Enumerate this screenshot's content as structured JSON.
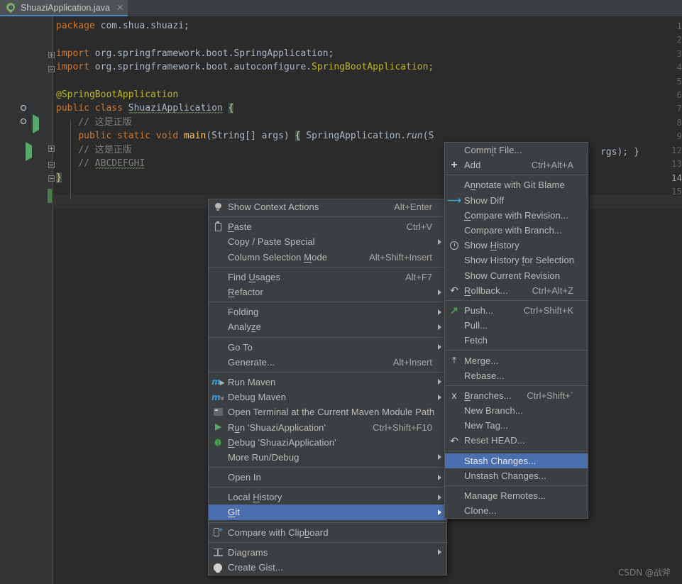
{
  "window": {
    "theme_bg": "#2b2b2b",
    "accent": "#4b6eaf",
    "menu_bg": "#3c3f41"
  },
  "tab": {
    "title": "ShuaziApplication.java",
    "close_label": "✕",
    "icon": "spring-boot-class-icon"
  },
  "editor": {
    "lines": [
      {
        "num": "1",
        "segments": [
          {
            "t": "package ",
            "c": "kw"
          },
          {
            "t": "com.shua.shuazi;",
            "c": "id"
          }
        ]
      },
      {
        "num": "2",
        "segments": []
      },
      {
        "num": "3",
        "segments": [
          {
            "t": "import ",
            "c": "kw"
          },
          {
            "t": "org.springframework.boot.SpringApplication;",
            "c": "id"
          }
        ]
      },
      {
        "num": "4",
        "segments": [
          {
            "t": "import ",
            "c": "kw"
          },
          {
            "t": "org.springframework.boot.autoconfigure.",
            "c": "id"
          },
          {
            "t": "SpringBootApplication;",
            "c": "ann"
          }
        ]
      },
      {
        "num": "5",
        "segments": []
      },
      {
        "num": "6",
        "segments": [
          {
            "t": "@SpringBootApplication",
            "c": "ann"
          }
        ]
      },
      {
        "num": "7",
        "segments": [
          {
            "t": "public ",
            "c": "kw"
          },
          {
            "t": "class ",
            "c": "kw"
          },
          {
            "t": "ShuaziApplication",
            "c": "squig"
          },
          {
            "t": " ",
            "c": "id"
          },
          {
            "t": "{",
            "c": "brace-hl"
          }
        ]
      },
      {
        "num": "8",
        "segments": [
          {
            "t": "    // 这是正版",
            "c": "cmt"
          }
        ]
      },
      {
        "num": "9",
        "segments": [
          {
            "t": "    ",
            "c": "id"
          },
          {
            "t": "public ",
            "c": "kw"
          },
          {
            "t": "static ",
            "c": "kw"
          },
          {
            "t": "void ",
            "c": "kw"
          },
          {
            "t": "main",
            "c": "mth"
          },
          {
            "t": "(String[] args) ",
            "c": "id"
          },
          {
            "t": "{",
            "c": "brace-hl"
          },
          {
            "t": " SpringApplication.",
            "c": "id"
          },
          {
            "t": "run",
            "c": "itl"
          },
          {
            "t": "(S",
            "c": "id"
          }
        ]
      },
      {
        "num": "12",
        "segments": [
          {
            "t": "    // 这是正版",
            "c": "cmt"
          }
        ]
      },
      {
        "num": "13",
        "segments": [
          {
            "t": "    // ",
            "c": "cmt"
          },
          {
            "t": "ABCDEFGHI",
            "c": "cmt squig"
          }
        ]
      },
      {
        "num": "14",
        "segments": [
          {
            "t": "}",
            "c": "brace-hl"
          }
        ]
      },
      {
        "num": "15",
        "segments": []
      }
    ],
    "line9_tail": "rgs); }",
    "current_line": "14"
  },
  "context_menu": {
    "items": [
      {
        "label": "Show Context Actions",
        "accel": "Alt+Enter",
        "icon": "lightbulb-icon",
        "arrow": false,
        "sep_after": true
      },
      {
        "label": "Paste",
        "mnemonic": "P",
        "accel": "Ctrl+V",
        "icon": "clipboard-icon",
        "arrow": false
      },
      {
        "label": "Copy / Paste Special",
        "accel": "",
        "icon": "",
        "arrow": true
      },
      {
        "label": "Column Selection Mode",
        "mnemonic": "M",
        "accel": "Alt+Shift+Insert",
        "icon": "",
        "arrow": false,
        "sep_after": true
      },
      {
        "label": "Find Usages",
        "mnemonic": "U",
        "accel": "Alt+F7",
        "icon": "",
        "arrow": false
      },
      {
        "label": "Refactor",
        "mnemonic": "R",
        "accel": "",
        "icon": "",
        "arrow": true,
        "sep_after": true
      },
      {
        "label": "Folding",
        "accel": "",
        "icon": "",
        "arrow": true
      },
      {
        "label": "Analyze",
        "mnemonic": "z",
        "accel": "",
        "icon": "",
        "arrow": true,
        "sep_after": true
      },
      {
        "label": "Go To",
        "accel": "",
        "icon": "",
        "arrow": true
      },
      {
        "label": "Generate...",
        "accel": "Alt+Insert",
        "icon": "",
        "arrow": false,
        "sep_after": true
      },
      {
        "label": "Run Maven",
        "accel": "",
        "icon": "maven-run-icon",
        "arrow": true
      },
      {
        "label": "Debug Maven",
        "accel": "",
        "icon": "maven-debug-icon",
        "arrow": true
      },
      {
        "label": "Open Terminal at the Current Maven Module Path",
        "accel": "",
        "icon": "terminal-icon",
        "arrow": false
      },
      {
        "label": "Run 'ShuaziApplication'",
        "mnemonic": "u",
        "accel": "Ctrl+Shift+F10",
        "icon": "run-play-icon",
        "arrow": false
      },
      {
        "label": "Debug 'ShuaziApplication'",
        "mnemonic": "D",
        "accel": "",
        "icon": "debug-bug-icon",
        "arrow": false
      },
      {
        "label": "More Run/Debug",
        "accel": "",
        "icon": "",
        "arrow": true,
        "sep_after": true
      },
      {
        "label": "Open In",
        "accel": "",
        "icon": "",
        "arrow": true,
        "sep_after": true
      },
      {
        "label": "Local History",
        "mnemonic": "H",
        "accel": "",
        "icon": "",
        "arrow": true
      },
      {
        "label": "Git",
        "mnemonic": "G",
        "accel": "",
        "icon": "",
        "arrow": true,
        "selected": true,
        "sep_after": true
      },
      {
        "label": "Compare with Clipboard",
        "mnemonic": "b",
        "accel": "",
        "icon": "compare-clipboard-icon",
        "arrow": false,
        "sep_after": true
      },
      {
        "label": "Diagrams",
        "accel": "",
        "icon": "diagram-icon",
        "arrow": true
      },
      {
        "label": "Create Gist...",
        "accel": "",
        "icon": "github-icon",
        "arrow": false
      }
    ]
  },
  "git_submenu": {
    "items": [
      {
        "label": "Commit File...",
        "mnemonic": "i",
        "accel": "",
        "icon": ""
      },
      {
        "label": "Add",
        "accel": "Ctrl+Alt+A",
        "icon": "plus-icon",
        "sep_after": true
      },
      {
        "label": "Annotate with Git Blame",
        "mnemonic": "n",
        "accel": "",
        "icon": ""
      },
      {
        "label": "Show Diff",
        "accel": "",
        "icon": "show-diff-icon"
      },
      {
        "label": "Compare with Revision...",
        "mnemonic": "C",
        "accel": "",
        "icon": ""
      },
      {
        "label": "Compare with Branch...",
        "accel": "",
        "icon": ""
      },
      {
        "label": "Show History",
        "mnemonic": "H",
        "accel": "",
        "icon": "clock-icon"
      },
      {
        "label": "Show History for Selection",
        "mnemonic": "f",
        "accel": "",
        "icon": ""
      },
      {
        "label": "Show Current Revision",
        "accel": "",
        "icon": ""
      },
      {
        "label": "Rollback...",
        "mnemonic": "R",
        "accel": "Ctrl+Alt+Z",
        "icon": "undo-icon",
        "sep_after": true
      },
      {
        "label": "Push...",
        "accel": "Ctrl+Shift+K",
        "icon": "push-arrow-icon"
      },
      {
        "label": "Pull...",
        "accel": "",
        "icon": ""
      },
      {
        "label": "Fetch",
        "accel": "",
        "icon": "",
        "sep_after": true
      },
      {
        "label": "Merge...",
        "accel": "",
        "icon": "merge-icon"
      },
      {
        "label": "Rebase...",
        "accel": "",
        "icon": "",
        "sep_after": true
      },
      {
        "label": "Branches...",
        "mnemonic": "B",
        "accel": "Ctrl+Shift+`",
        "icon": "branch-icon"
      },
      {
        "label": "New Branch...",
        "accel": "",
        "icon": ""
      },
      {
        "label": "New Tag...",
        "accel": "",
        "icon": ""
      },
      {
        "label": "Reset HEAD...",
        "accel": "",
        "icon": "undo-icon",
        "sep_after": true
      },
      {
        "label": "Stash Changes...",
        "accel": "",
        "icon": "",
        "selected": true
      },
      {
        "label": "Unstash Changes...",
        "accel": "",
        "icon": "",
        "sep_after": true
      },
      {
        "label": "Manage Remotes...",
        "accel": "",
        "icon": ""
      },
      {
        "label": "Clone...",
        "accel": "",
        "icon": ""
      }
    ]
  },
  "watermark": "CSDN @战斧"
}
